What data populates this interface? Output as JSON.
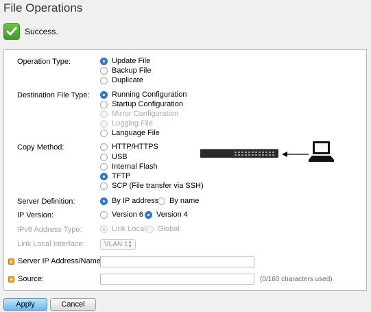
{
  "page": {
    "title": "File Operations"
  },
  "status": {
    "message": "Success.",
    "icon": "checkmark-icon"
  },
  "form": {
    "operation_type": {
      "label": "Operation Type:",
      "options": [
        "Update File",
        "Backup File",
        "Duplicate"
      ],
      "selected": "Update File"
    },
    "destination_file_type": {
      "label": "Destination File Type:",
      "options": [
        "Running Configuration",
        "Startup Configuration",
        "Mirror Configuration",
        "Logging File",
        "Language File"
      ],
      "disabled": [
        "Mirror Configuration",
        "Logging File"
      ],
      "selected": "Running Configuration"
    },
    "copy_method": {
      "label": "Copy Method:",
      "options": [
        "HTTP/HTTPS",
        "USB",
        "Internal Flash",
        "TFTP",
        "SCP (File transfer via SSH)"
      ],
      "selected": "TFTP"
    },
    "server_definition": {
      "label": "Server Definition:",
      "options": [
        "By IP address",
        "By name"
      ],
      "selected": "By IP address"
    },
    "ip_version": {
      "label": "IP Version:",
      "options": [
        "Version 6",
        "Version 4"
      ],
      "selected": "Version 4"
    },
    "ipv6_address_type": {
      "label": "IPv6 Address Type:",
      "options": [
        "Link Local",
        "Global"
      ],
      "selected": "Link Local",
      "disabled": true
    },
    "link_local_interface": {
      "label": "Link Local Interface:",
      "value": "VLAN 1",
      "disabled": true
    },
    "server_ip": {
      "label": "Server IP Address/Name:",
      "value": ""
    },
    "source": {
      "label": "Source:",
      "value": "",
      "hint": "(0/160 characters used)"
    }
  },
  "buttons": {
    "apply": "Apply",
    "cancel": "Cancel"
  },
  "diagram": {
    "switch_icon": "network-switch-icon",
    "computer_icon": "laptop-icon",
    "arrow_icon": "arrow-left-icon"
  },
  "colors": {
    "selected_radio": "#2f7fd9",
    "required_marker": "#f0a030",
    "success": "#4caf2e",
    "apply_button": "#7fc0ee"
  }
}
